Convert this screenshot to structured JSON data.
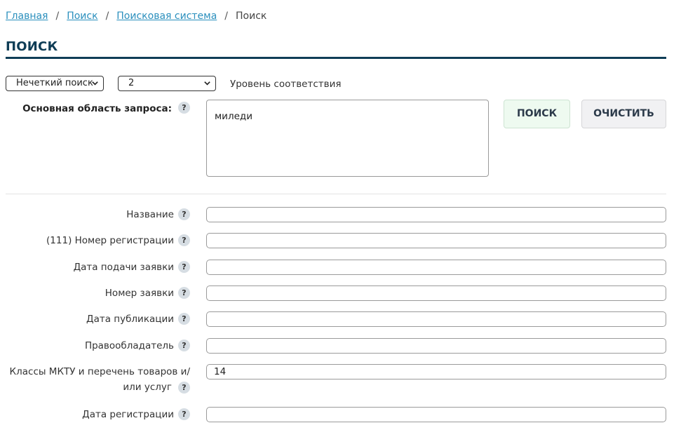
{
  "breadcrumb": {
    "items": [
      "Главная",
      "Поиск",
      "Поисковая система"
    ],
    "current": "Поиск",
    "separator": "/"
  },
  "page_title": "ПОИСК",
  "controls": {
    "mode_select": "Нечеткий поиск",
    "level_select": "2",
    "level_label": "Уровень соответствия"
  },
  "main_query": {
    "label": "Основная область запроса:",
    "value": "миледи"
  },
  "buttons": {
    "search": "ПОИСК",
    "clear": "ОЧИСТИТЬ"
  },
  "help_glyph": "?",
  "fields": [
    {
      "label": "Название",
      "value": ""
    },
    {
      "label": "(111) Номер регистрации",
      "value": ""
    },
    {
      "label": "Дата подачи заявки",
      "value": ""
    },
    {
      "label": "Номер заявки",
      "value": ""
    },
    {
      "label": "Дата публикации",
      "value": ""
    },
    {
      "label": "Правообладатель",
      "value": ""
    },
    {
      "label_line1": "Классы МКТУ и перечень товаров и/",
      "label_line2": "или услуг",
      "value": "14"
    },
    {
      "label": "Дата регистрации",
      "value": ""
    }
  ],
  "colors": {
    "link": "#2a8fbd",
    "title": "#0f3d56",
    "search_button_bg": "#eefaf0",
    "clear_button_bg": "#f1f1f3",
    "help_badge": "#d6dde3"
  },
  "icons": [
    "chevron-down-icon",
    "help-icon"
  ]
}
